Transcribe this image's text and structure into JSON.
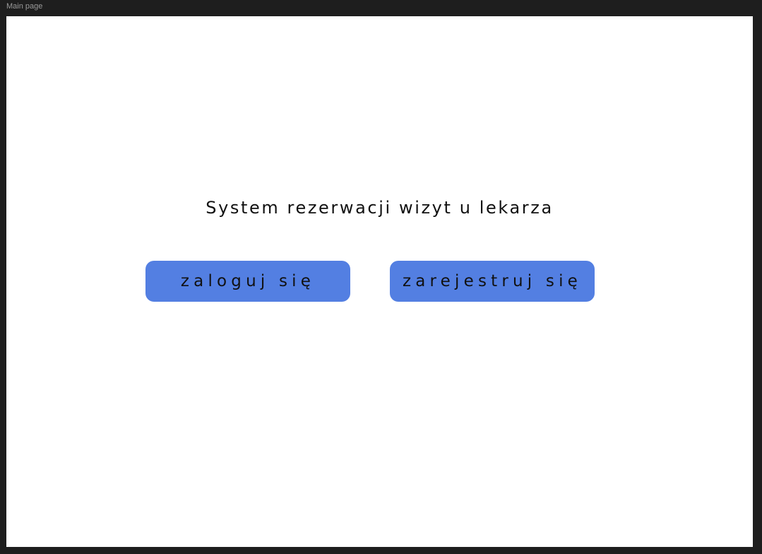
{
  "frame": {
    "label": "Main page"
  },
  "main": {
    "title": "System rezerwacji wizyt u lekarza",
    "login_button": "zaloguj się",
    "register_button": "zarejestruj się"
  },
  "colors": {
    "button_background": "#537fe2",
    "canvas_background": "#1e1e1e",
    "frame_background": "#ffffff"
  }
}
